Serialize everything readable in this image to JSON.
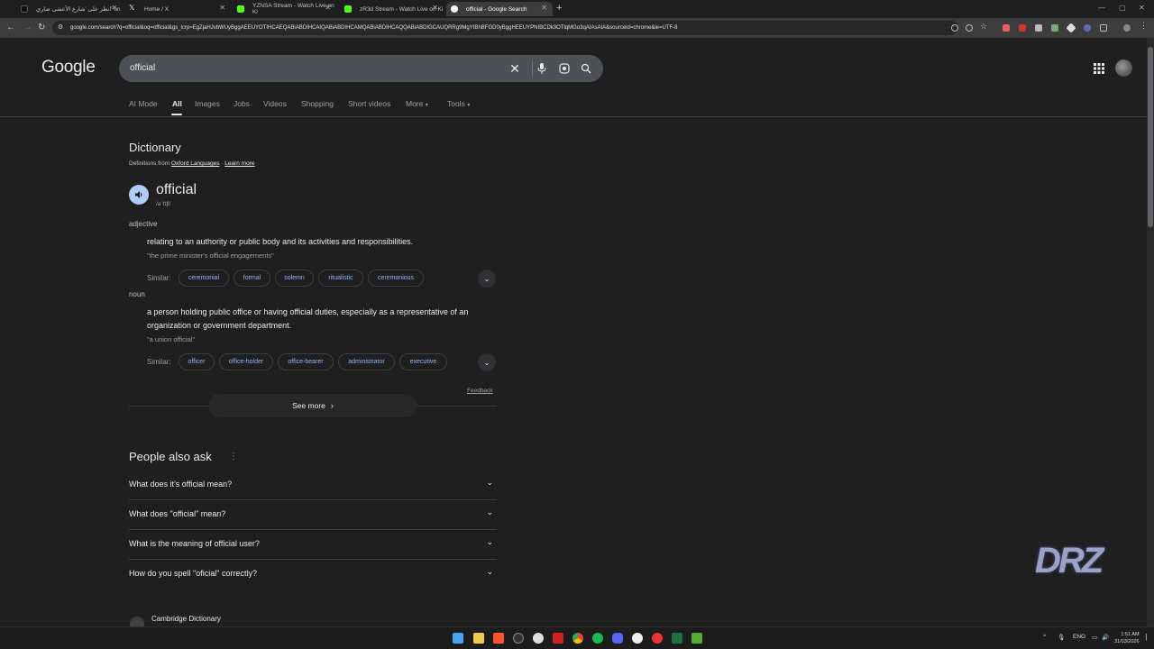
{
  "browser": {
    "tabs": [
      {
        "title": "انظر على 'شارع الأعشى ضاري' on",
        "icon": "tiktok-icon",
        "active": false
      },
      {
        "title": "Home / X",
        "icon": "x-icon",
        "active": false
      },
      {
        "title": "YZNSA Stream - Watch Live on Ki",
        "icon": "kick-icon",
        "active": false
      },
      {
        "title": "zR3d Stream - Watch Live on Ki",
        "icon": "kick-icon",
        "active": false
      },
      {
        "title": "official - Google Search",
        "icon": "google-icon",
        "active": true
      }
    ],
    "url": "google.com/search?q=official&oq=official&gs_lcrp=EgZjaHJvbWUyBggAEEUYOTIHCAEQABiABDIHCAIQABiABDIHCAMQABiABDIHCAQQABiABDIGCAUQRRg9MgYIBhBFGD0yBggHEEUYPNIBCDk3OTlqMGo3qAIAsAIA&sourceid=chrome&ie=UTF-8"
  },
  "google": {
    "logo": "Google",
    "query": "official",
    "nav": [
      "AI Mode",
      "All",
      "Images",
      "Jobs",
      "Videos",
      "Shopping",
      "Short videos",
      "More",
      "Tools"
    ]
  },
  "dictionary": {
    "heading": "Dictionary",
    "defs_prefix": "Definitions from",
    "oxford": "Oxford Languages",
    "separator": "·",
    "learn_more": "Learn more",
    "word": "official",
    "phonetic": "/əˈfɪʃl/",
    "senses": [
      {
        "pos": "adjective",
        "definition": "relating to an authority or public body and its activities and responsibilities.",
        "example": "\"the prime minister's official engagements\"",
        "similar_label": "Similar:",
        "similar": [
          "ceremonial",
          "formal",
          "solemn",
          "ritualistic",
          "ceremonious"
        ]
      },
      {
        "pos": "noun",
        "definition": "a person holding public office or having official duties, especially as a representative of an organization or government department.",
        "example": "\"a union official\"",
        "similar_label": "Similar:",
        "similar": [
          "officer",
          "office-holder",
          "office-bearer",
          "administrator",
          "executive"
        ]
      }
    ],
    "feedback": "Feedback",
    "see_more": "See more"
  },
  "paa": {
    "heading": "People also ask",
    "questions": [
      "What does it's official mean?",
      "What does \"official\" mean?",
      "What is the meaning of official user?",
      "How do you spell \"oficial\" correctly?"
    ]
  },
  "result": {
    "source": "Cambridge Dictionary"
  },
  "watermark": "DRZ",
  "taskbar": {
    "lang": "ENG",
    "time": "1:51 AM",
    "date": "31/03/2026"
  },
  "colors": {
    "link": "#8ab4f8",
    "bg": "#1f1f1f",
    "speaker": "#aecbfa"
  }
}
